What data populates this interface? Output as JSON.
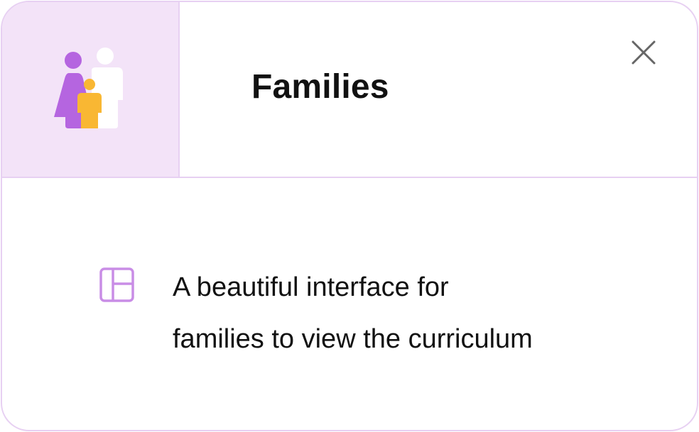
{
  "card": {
    "title": "Families",
    "description_lines": [
      "A beautiful interface for",
      "families to view the curriculum"
    ]
  },
  "icons": {
    "header_icon": "family-icon",
    "close": "close-icon",
    "feature": "layout-icon"
  },
  "colors": {
    "border": "#e7d0f2",
    "tile_background": "#f3e3f8",
    "purple": "#b565e0",
    "yellow": "#f9b733",
    "feature_icon": "#c98de6",
    "close_icon": "#666666"
  }
}
